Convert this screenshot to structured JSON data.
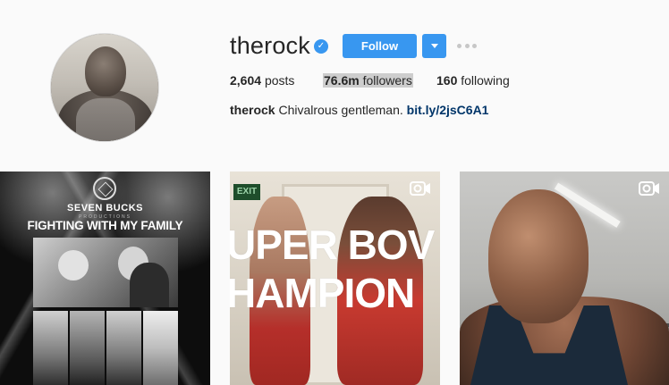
{
  "profile": {
    "username": "therock",
    "verified": true,
    "follow_label": "Follow",
    "stats": {
      "posts_count": "2,604",
      "posts_label": "posts",
      "followers_count": "76.6m",
      "followers_label": "followers",
      "following_count": "160",
      "following_label": "following"
    },
    "bio": {
      "name": "therock",
      "text": "Chivalrous gentleman.",
      "link": "bit.ly/2jsC6A1"
    }
  },
  "posts": [
    {
      "type": "image",
      "brand": "SEVEN BUCKS",
      "brand_sub": "PRODUCTIONS",
      "title": "FIGHTING WITH MY FAMILY"
    },
    {
      "type": "video",
      "sign": "EXIT",
      "line1": "UPER BOV",
      "line2": "HAMPION"
    },
    {
      "type": "video"
    }
  ],
  "colors": {
    "accent": "#3897f0",
    "link": "#003569",
    "background": "#fafafa"
  }
}
